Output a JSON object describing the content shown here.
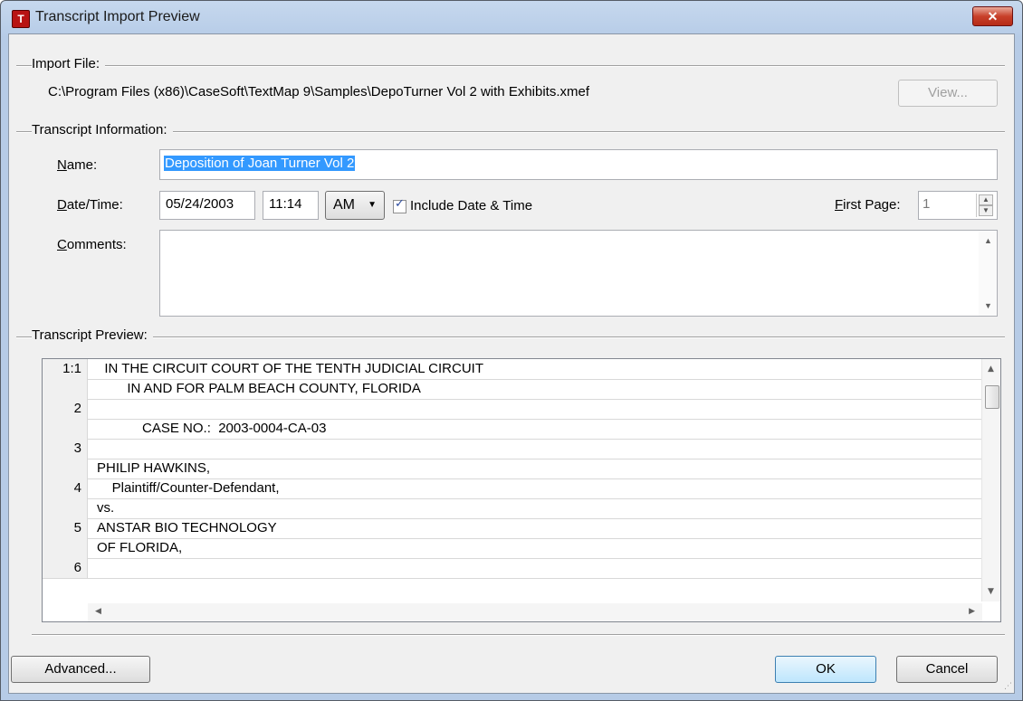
{
  "window": {
    "title": "Transcript Import Preview",
    "icon": "app-icon",
    "close_label": "✕"
  },
  "import_file": {
    "group_label": "Import File:",
    "path": "C:\\Program Files (x86)\\CaseSoft\\TextMap 9\\Samples\\DepoTurner Vol 2 with Exhibits.xmef",
    "view_button": "View..."
  },
  "transcript_info": {
    "group_label": "Transcript Information:",
    "name_label": "Name:",
    "name_value": "Deposition of Joan Turner Vol 2",
    "datetime_label": "Date/Time:",
    "date_value": "05/24/2003",
    "time_value": "11:14",
    "ampm_value": "AM",
    "include_datetime_label": "Include Date & Time",
    "include_datetime_checked": true,
    "first_page_label": "First Page:",
    "first_page_value": "1",
    "comments_label": "Comments:",
    "comments_value": ""
  },
  "preview": {
    "group_label": "Transcript Preview:",
    "lines": [
      {
        "num": "1:1",
        "text": "  IN THE CIRCUIT COURT OF THE TENTH JUDICIAL CIRCUIT"
      },
      {
        "num": "",
        "text": "        IN AND FOR PALM BEACH COUNTY, FLORIDA"
      },
      {
        "num": "2",
        "text": ""
      },
      {
        "num": "",
        "text": "            CASE NO.:  2003-0004-CA-03"
      },
      {
        "num": "3",
        "text": ""
      },
      {
        "num": "",
        "text": "PHILIP HAWKINS,"
      },
      {
        "num": "4",
        "text": "    Plaintiff/Counter-Defendant,"
      },
      {
        "num": "",
        "text": "vs."
      },
      {
        "num": "5",
        "text": "ANSTAR BIO TECHNOLOGY"
      },
      {
        "num": "",
        "text": "OF FLORIDA,"
      },
      {
        "num": "6",
        "text": ""
      }
    ]
  },
  "buttons": {
    "advanced": "Advanced...",
    "ok": "OK",
    "cancel": "Cancel"
  }
}
